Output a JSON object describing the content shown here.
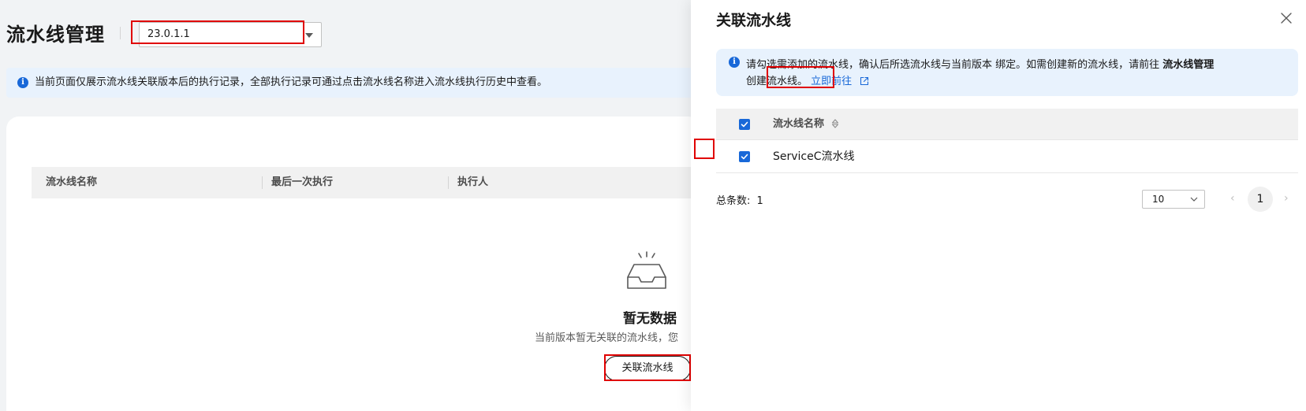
{
  "page": {
    "title": "流水线管理",
    "version_selected": "23.0.1.1",
    "notice": "当前页面仅展示流水线关联版本后的执行记录，全部执行记录可通过点击流水线名称进入流水线执行历史中查看。",
    "table": {
      "columns": [
        "流水线名称",
        "最后一次执行",
        "执行人"
      ]
    },
    "empty": {
      "title": "暂无数据",
      "desc": "当前版本暂无关联的流水线，您",
      "button": "关联流水线"
    }
  },
  "drawer": {
    "title": "关联流水线",
    "notice": {
      "line1": "请勾选需添加的流水线，确认后所选流水线与当前版本    绑定。如需创建新的流水线，请前往",
      "line1_bold": "流水线管理",
      "line2": "创建流水线。",
      "link": "立即前往"
    },
    "table": {
      "column": "流水线名称",
      "rows": [
        {
          "name": "ServiceC流水线",
          "checked": true
        }
      ],
      "header_checked": true
    },
    "pagination": {
      "total_label": "总条数:",
      "total": "1",
      "page_size": "10",
      "current": "1"
    }
  },
  "colors": {
    "accent": "#1868d8",
    "highlight": "#e00000",
    "notice_bg": "#e8f2fd"
  }
}
